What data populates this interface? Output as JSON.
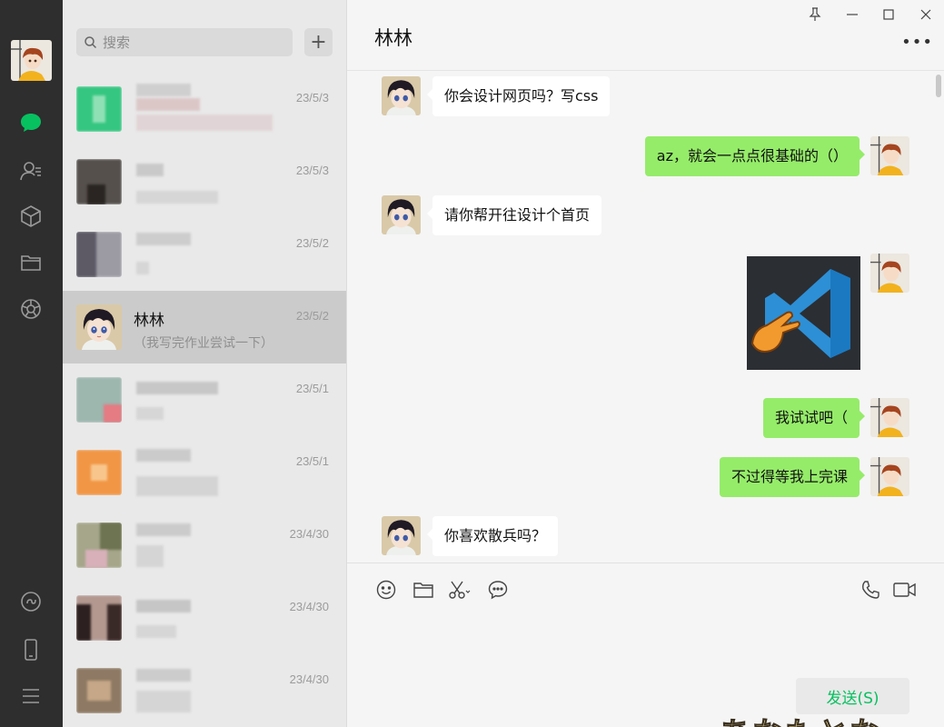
{
  "search": {
    "placeholder": "搜索"
  },
  "list_plus": "+",
  "conversations": [
    {
      "date": "23/5/3"
    },
    {
      "date": "23/5/3"
    },
    {
      "date": "23/5/2"
    },
    {
      "name": "林林",
      "date": "23/5/2",
      "preview": "（我写完作业尝试一下）"
    },
    {
      "date": "23/5/1"
    },
    {
      "date": "23/5/1"
    },
    {
      "date": "23/4/30"
    },
    {
      "date": "23/4/30"
    },
    {
      "date": "23/4/30"
    }
  ],
  "chat": {
    "title": "林林",
    "more": "•••",
    "messages": [
      {
        "from": "them",
        "text": "你会设计网页吗？写css"
      },
      {
        "from": "me",
        "text": "az，就会一点点很基础的（）"
      },
      {
        "from": "them",
        "text": "请你帮开往设计个首页"
      },
      {
        "from": "me",
        "type": "image",
        "image": "vscode-logo"
      },
      {
        "from": "me",
        "text": "我试试吧（"
      },
      {
        "from": "me",
        "text": "不过得等我上完课"
      },
      {
        "from": "them",
        "text": "你喜欢散兵吗？"
      }
    ],
    "send_label": "发送(S)",
    "watermark": "あなたとな"
  },
  "colors": {
    "sent_bubble": "#95ec69",
    "send_text": "#07c160",
    "nav_bg": "#2e2e2e",
    "active_chat_icon": "#07c160"
  }
}
